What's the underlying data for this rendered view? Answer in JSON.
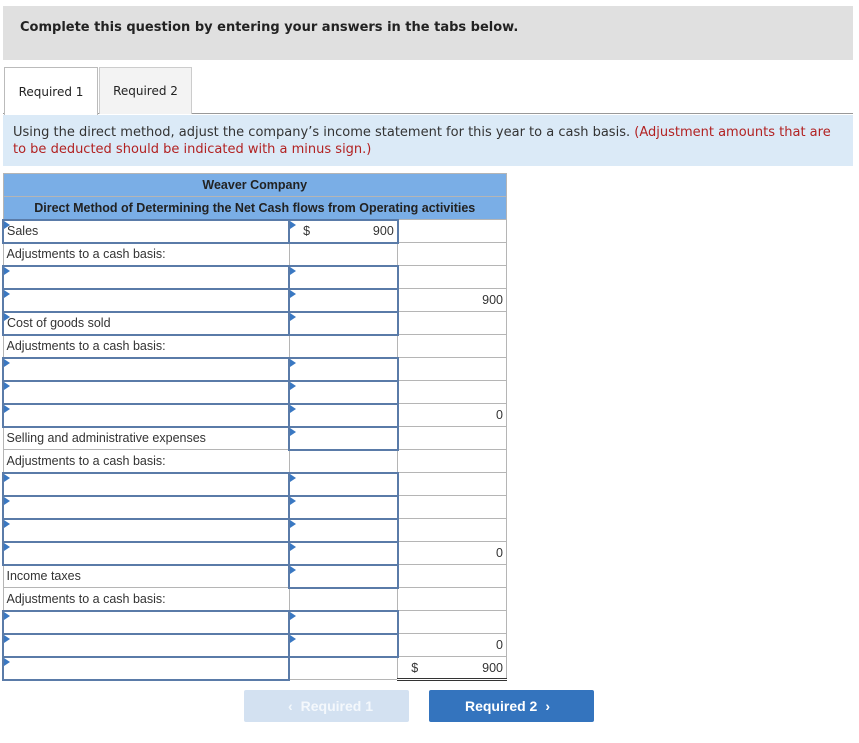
{
  "banner": {
    "text": "Complete this question by entering your answers in the tabs below."
  },
  "tabs": [
    {
      "label": "Required 1",
      "active": true
    },
    {
      "label": "Required 2",
      "active": false
    }
  ],
  "instructions": {
    "main": "Using the direct method, adjust the company’s income statement for this year to a cash basis.",
    "note": "(Adjustment amounts that are to be deducted should be indicated with a minus sign.)"
  },
  "statement": {
    "company": "Weaver Company",
    "title": "Direct Method of Determining the Net Cash flows from Operating activities",
    "currency": "$",
    "adj_label": "Adjustments to a cash basis:",
    "sales": {
      "label": "Sales",
      "amount": "900",
      "subtotal": "900"
    },
    "cogs": {
      "label": "Cost of goods sold",
      "amount": "",
      "subtotal": "0"
    },
    "sga": {
      "label": "Selling and administrative expenses",
      "amount": "",
      "subtotal": "0"
    },
    "taxes": {
      "label": "Income taxes",
      "amount": "",
      "subtotal": "0"
    },
    "total": "900"
  },
  "nav": {
    "prev_label": "Required 1",
    "next_label": "Required 2",
    "prev_icon": "‹",
    "next_icon": "›"
  }
}
